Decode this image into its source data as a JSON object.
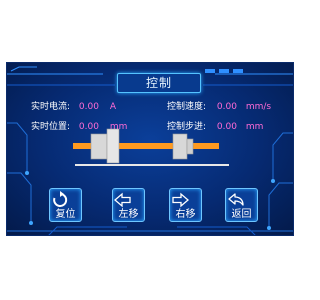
{
  "title": "控制",
  "realtime": {
    "current": {
      "label": "实时电流:",
      "value": "0.00",
      "unit": "A"
    },
    "position": {
      "label": "实时位置:",
      "value": "0.00",
      "unit": "mm"
    },
    "speed": {
      "label": "控制速度:",
      "value": "0.00",
      "unit": "mm/s"
    },
    "step": {
      "label": "控制步进:",
      "value": "0.00",
      "unit": "mm"
    }
  },
  "buttons": [
    {
      "label": "复位",
      "icon": "reset-icon"
    },
    {
      "label": "左移",
      "icon": "arrow-left-icon"
    },
    {
      "label": "右移",
      "icon": "arrow-right-icon"
    },
    {
      "label": "返回",
      "icon": "back-icon"
    }
  ],
  "colors": {
    "accent": "#55c3ff",
    "value": "#ff6bd6",
    "actuator": "#ff9a1f"
  }
}
